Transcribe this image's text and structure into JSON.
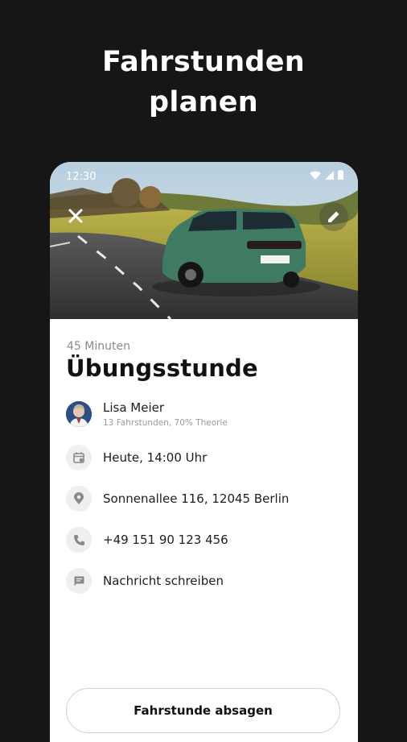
{
  "headline": {
    "line1": "Fahrstunden",
    "line2": "planen"
  },
  "status_bar": {
    "time": "12:30"
  },
  "hero": {
    "alt_icons": [
      "close-icon",
      "edit-icon"
    ]
  },
  "lesson": {
    "duration": "45 Minuten",
    "title": "Übungsstunde"
  },
  "teacher": {
    "name": "Lisa Meier",
    "subtitle": "13 Fahrstunden, 70% Theorie"
  },
  "details": {
    "datetime": "Heute, 14:00 Uhr",
    "address": "Sonnenallee 116, 12045 Berlin",
    "phone": "+49 151 90 123 456",
    "message": "Nachricht schreiben"
  },
  "actions": {
    "cancel_label": "Fahrstunde absagen"
  },
  "colors": {
    "background": "#161616",
    "card": "#ffffff",
    "car": "#3f7a62"
  }
}
